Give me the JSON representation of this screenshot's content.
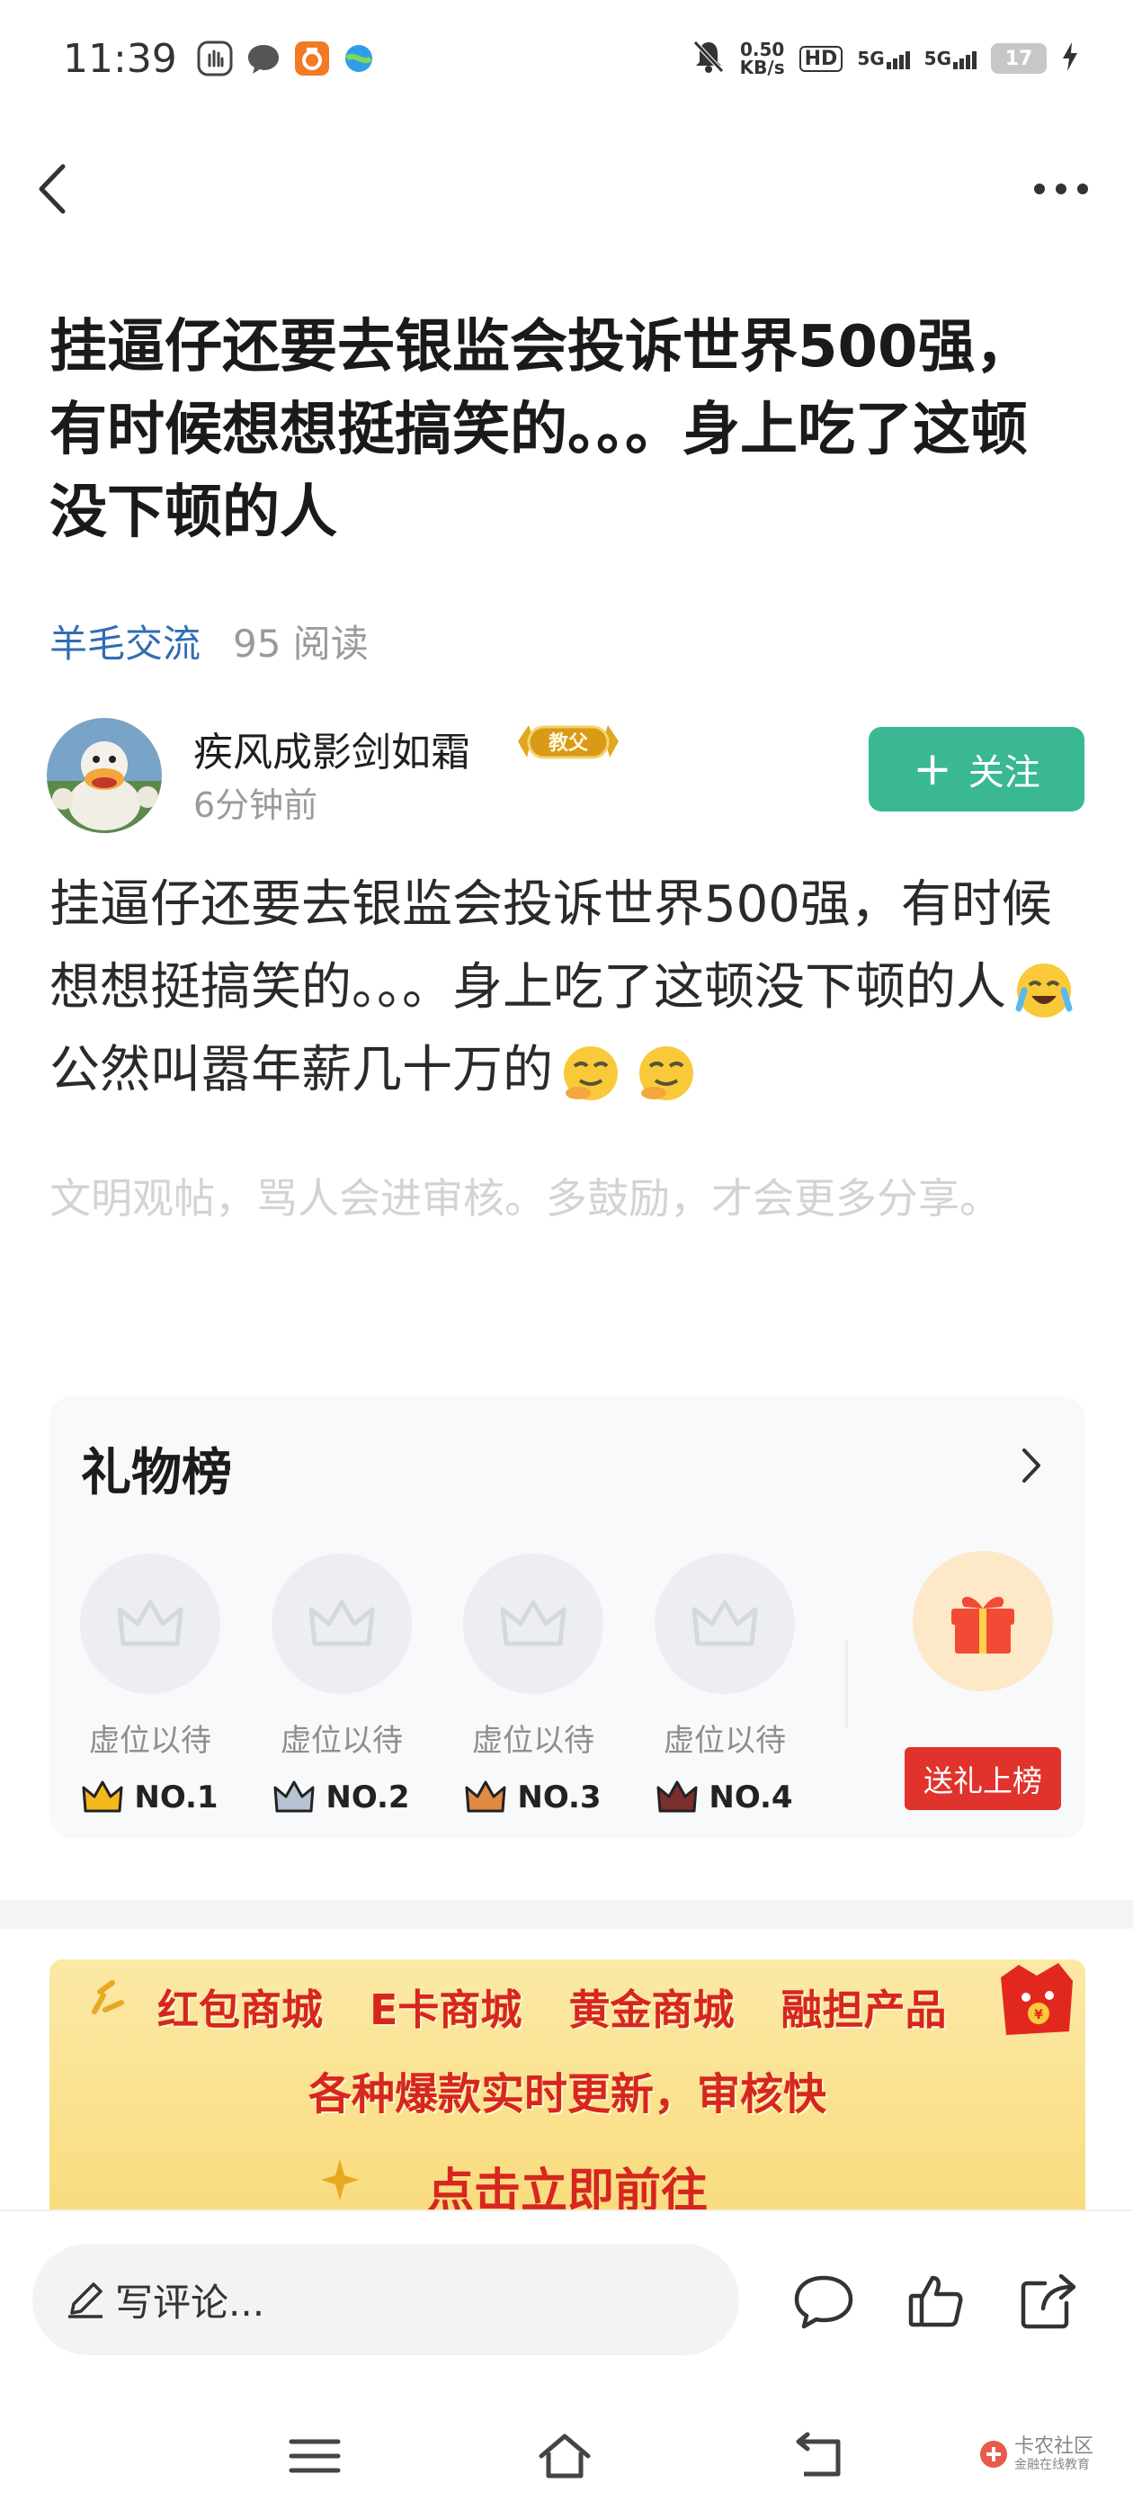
{
  "status_bar": {
    "time": "11:39",
    "net_speed_value": "0.50",
    "net_speed_unit": "KB/s",
    "hd_label": "HD",
    "network_1": "5G",
    "network_2": "5G",
    "battery": "17"
  },
  "nav": {
    "back_icon": "chevron-left-icon",
    "more_icon": "more-dots-icon"
  },
  "post": {
    "title": "挂逼仔还要去银监会投诉世界500强，有时候想想挺搞笑的。。。身上吃了这顿没下顿的人",
    "board": "羊毛交流",
    "read_count": "95 阅读",
    "author": {
      "name": "疾风成影剑如霜",
      "badge": "教父",
      "time": "6分钟前"
    },
    "follow_label": "关注",
    "body_part1": "挂逼仔还要去银监会投诉世界500强，有时候想想挺搞笑的。。。身上吃了这顿没下顿的人",
    "body_part2": "公然叫嚣年薪几十万的",
    "hint": "文明观帖，骂人会进审核。多鼓励，才会更多分享。"
  },
  "gift_board": {
    "title": "礼物榜",
    "slots": [
      {
        "label": "虚位以待",
        "rank": "NO.1",
        "crown_color": "#e8a820"
      },
      {
        "label": "虚位以待",
        "rank": "NO.2",
        "crown_color": "#9aa6b8"
      },
      {
        "label": "虚位以待",
        "rank": "NO.3",
        "crown_color": "#d98a4a"
      },
      {
        "label": "虚位以待",
        "rank": "NO.4",
        "crown_color": "#8a3a3a"
      }
    ],
    "send_label": "送礼上榜"
  },
  "banner": {
    "items": [
      "红包商城",
      "E卡商城",
      "黄金商城",
      "融担产品"
    ],
    "subtitle": "各种爆款实时更新，审核快",
    "cta": "点击立即前往"
  },
  "comment_bar": {
    "placeholder": "写评论..."
  },
  "watermark": {
    "title": "卡农社区",
    "subtitle": "金融在线教育"
  },
  "colors": {
    "accent_green": "#3ab894",
    "link_blue": "#2f6db5",
    "gift_red": "#e0332c",
    "banner_red": "#d6261f"
  }
}
